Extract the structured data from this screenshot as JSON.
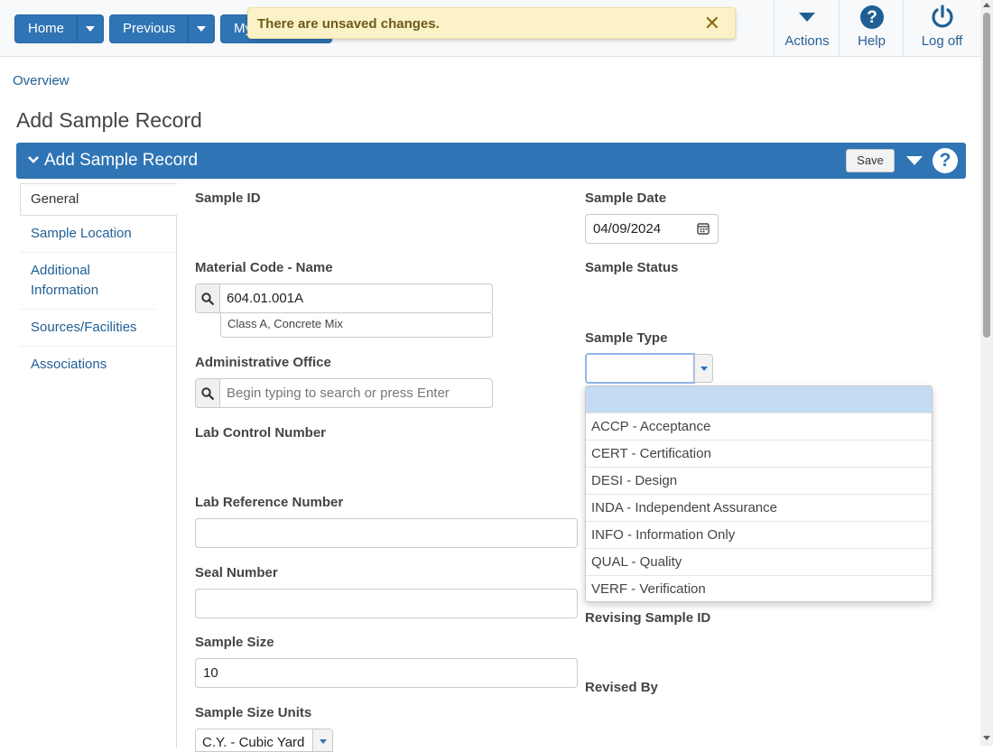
{
  "toolbar": {
    "home_label": "Home",
    "previous_label": "Previous",
    "my_label": "My",
    "notification": "There are unsaved changes.",
    "close_glyph": "✕",
    "actions_label": "Actions",
    "help_label": "Help",
    "logoff_label": "Log off"
  },
  "breadcrumb": "Overview",
  "page_title": "Add Sample Record",
  "panel": {
    "title": "Add Sample Record",
    "save_label": "Save",
    "help_glyph": "?"
  },
  "sidebar": {
    "items": [
      {
        "label": "General"
      },
      {
        "label": "Sample Location"
      },
      {
        "label": "Additional Information"
      },
      {
        "label": "Sources/Facilities"
      },
      {
        "label": "Associations"
      }
    ]
  },
  "form": {
    "sample_id_label": "Sample ID",
    "sample_date_label": "Sample Date",
    "sample_date_value": "04/09/2024",
    "material_label": "Material Code - Name",
    "material_value": "604.01.001A",
    "material_desc": "Class A, Concrete Mix",
    "sample_status_label": "Sample Status",
    "sample_type_label": "Sample Type",
    "admin_office_label": "Administrative Office",
    "admin_office_placeholder": "Begin typing to search or press Enter",
    "lab_control_label": "Lab Control Number",
    "lab_reference_label": "Lab Reference Number",
    "seal_number_label": "Seal Number",
    "sample_size_label": "Sample Size",
    "sample_size_value": "10",
    "sample_size_units_label": "Sample Size Units",
    "sample_size_units_value": "C.Y. - Cubic Yard",
    "revising_sample_label": "Revising Sample ID",
    "revised_by_label": "Revised By"
  },
  "sample_type_options": [
    "",
    "ACCP - Acceptance",
    "CERT - Certification",
    "DESI - Design",
    "INDA - Independent Assurance",
    "INFO - Information Only",
    "QUAL - Quality",
    "VERF - Verification"
  ],
  "colors": {
    "primary": "#2f74b5",
    "link": "#1f5f94",
    "notification_bg": "#fcf2c8",
    "selected_option": "#c4dcf2"
  }
}
